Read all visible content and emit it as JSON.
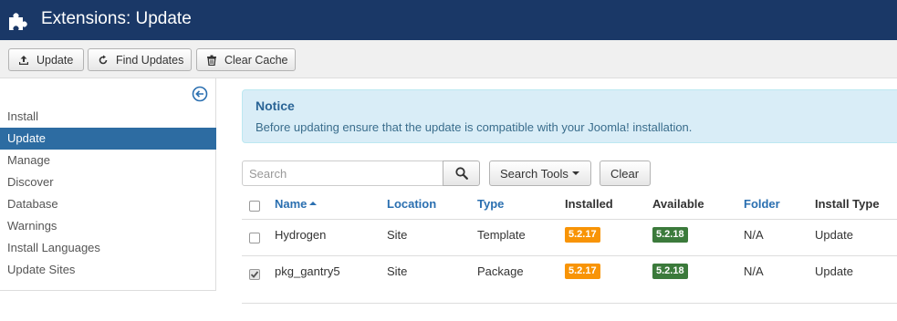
{
  "header": {
    "title": "Extensions: Update",
    "icon": "puzzle-icon"
  },
  "toolbar": {
    "update_label": "Update",
    "find_updates_label": "Find Updates",
    "clear_cache_label": "Clear Cache"
  },
  "sidebar": {
    "items": [
      {
        "label": "Install",
        "active": false
      },
      {
        "label": "Update",
        "active": true
      },
      {
        "label": "Manage",
        "active": false
      },
      {
        "label": "Discover",
        "active": false
      },
      {
        "label": "Database",
        "active": false
      },
      {
        "label": "Warnings",
        "active": false
      },
      {
        "label": "Install Languages",
        "active": false
      },
      {
        "label": "Update Sites",
        "active": false
      }
    ]
  },
  "notice": {
    "title": "Notice",
    "message": "Before updating ensure that the update is compatible with your Joomla! installation."
  },
  "filters": {
    "search_placeholder": "Search",
    "search_value": "",
    "search_tools_label": "Search Tools",
    "clear_label": "Clear"
  },
  "table": {
    "columns": {
      "name": "Name",
      "location": "Location",
      "type": "Type",
      "installed": "Installed",
      "available": "Available",
      "folder": "Folder",
      "install_type": "Install Type"
    },
    "rows": [
      {
        "checked": false,
        "name": "Hydrogen",
        "location": "Site",
        "type": "Template",
        "installed": "5.2.17",
        "available": "5.2.18",
        "folder": "N/A",
        "install_type": "Update"
      },
      {
        "checked": true,
        "name": "pkg_gantry5",
        "location": "Site",
        "type": "Package",
        "installed": "5.2.17",
        "available": "5.2.18",
        "folder": "N/A",
        "install_type": "Update"
      }
    ]
  },
  "colors": {
    "header_bg": "#1a3867",
    "active_nav": "#2d6ca2",
    "installed_badge": "#f89406",
    "available_badge": "#3b7a3b",
    "link": "#2a6fb0"
  }
}
